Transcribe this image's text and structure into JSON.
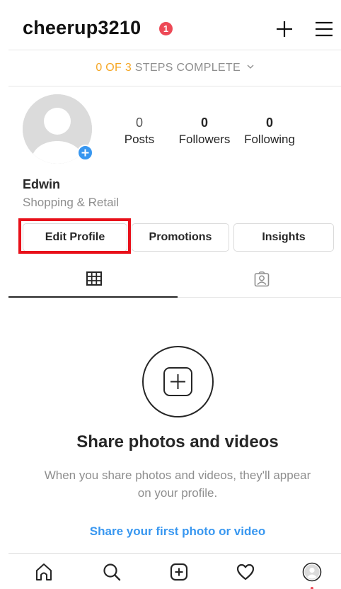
{
  "header": {
    "username": "cheerup3210",
    "notification_count": "1",
    "icons": [
      "plus-icon",
      "hamburger-menu-icon"
    ]
  },
  "steps": {
    "done": "0 OF 3",
    "rest": " STEPS COMPLETE"
  },
  "profile": {
    "stats": [
      {
        "value": "0",
        "label": "Posts"
      },
      {
        "value": "0",
        "label": "Followers"
      },
      {
        "value": "0",
        "label": "Following"
      }
    ],
    "name": "Edwin",
    "category": "Shopping & Retail"
  },
  "buttons": {
    "edit_profile": "Edit Profile",
    "promotions": "Promotions",
    "insights": "Insights"
  },
  "tabs": [
    "grid-icon",
    "tagged-icon"
  ],
  "empty_state": {
    "title": "Share photos and videos",
    "description": "When you share photos and videos, they'll appear on your profile.",
    "link": "Share your first photo or video"
  },
  "bottom_nav": [
    "home-icon",
    "search-icon",
    "new-post-icon",
    "activity-heart-icon",
    "profile-icon"
  ],
  "colors": {
    "badge": "#ed4956",
    "steps_done": "#f5a623",
    "link": "#3897f0",
    "highlight": "#e8101a"
  }
}
